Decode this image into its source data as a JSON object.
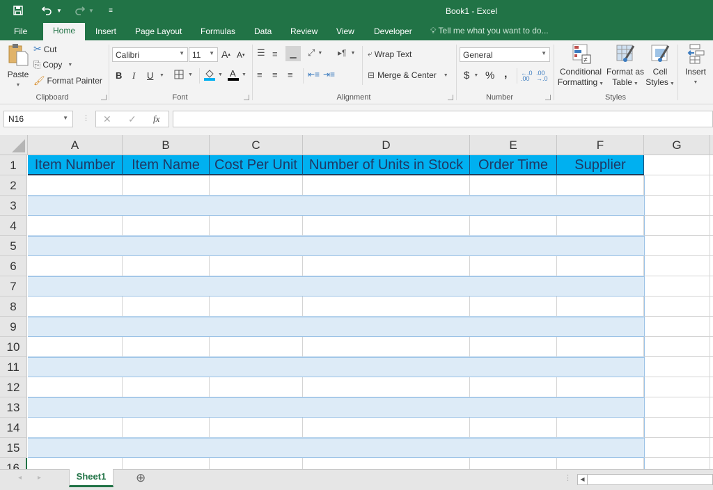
{
  "app": {
    "title": "Book1 - Excel"
  },
  "quick_access": {
    "save_icon": "save-icon",
    "undo_icon": "undo-icon",
    "redo_icon": "redo-icon",
    "customize_icon": "customize-qat-icon"
  },
  "menu_tabs": [
    {
      "label": "File"
    },
    {
      "label": "Home",
      "active": true
    },
    {
      "label": "Insert"
    },
    {
      "label": "Page Layout"
    },
    {
      "label": "Formulas"
    },
    {
      "label": "Data"
    },
    {
      "label": "Review"
    },
    {
      "label": "View"
    },
    {
      "label": "Developer"
    }
  ],
  "tell_me": {
    "placeholder": "Tell me what you want to do..."
  },
  "ribbon": {
    "clipboard": {
      "label": "Clipboard",
      "paste": "Paste",
      "cut": "Cut",
      "copy": "Copy",
      "format_painter": "Format Painter"
    },
    "font": {
      "label": "Font",
      "font_name": "Calibri",
      "font_size": "11",
      "bold": "B",
      "italic": "I",
      "underline": "U"
    },
    "alignment": {
      "label": "Alignment",
      "wrap_text": "Wrap Text",
      "merge_center": "Merge & Center"
    },
    "number": {
      "label": "Number",
      "format": "General",
      "currency": "$",
      "percent": "%",
      "comma": ","
    },
    "styles": {
      "label": "Styles",
      "conditional_formatting": [
        "Conditional",
        "Formatting"
      ],
      "format_as_table": [
        "Format as",
        "Table"
      ],
      "cell_styles": [
        "Cell",
        "Styles"
      ]
    },
    "cells": {
      "insert": "Insert"
    }
  },
  "formula_bar": {
    "name_box": "N16",
    "formula": "",
    "fx_label": "fx"
  },
  "sheet": {
    "columns": [
      "A",
      "B",
      "C",
      "D",
      "E",
      "F",
      "G"
    ],
    "rows": [
      "1",
      "2",
      "3",
      "4",
      "5",
      "6",
      "7",
      "8",
      "9",
      "10",
      "11",
      "12",
      "13",
      "14",
      "15",
      "16"
    ],
    "header_row": [
      "Item Number",
      "Item Name",
      "Cost Per Unit",
      "Number of Units in Stock",
      "Order Time",
      "Supplier"
    ],
    "header_fill": "#00b0f0",
    "band_fill": "#ddebf7"
  },
  "sheet_tabs": [
    {
      "label": "Sheet1",
      "active": true
    }
  ],
  "add_sheet_icon": "plus-circle-icon"
}
